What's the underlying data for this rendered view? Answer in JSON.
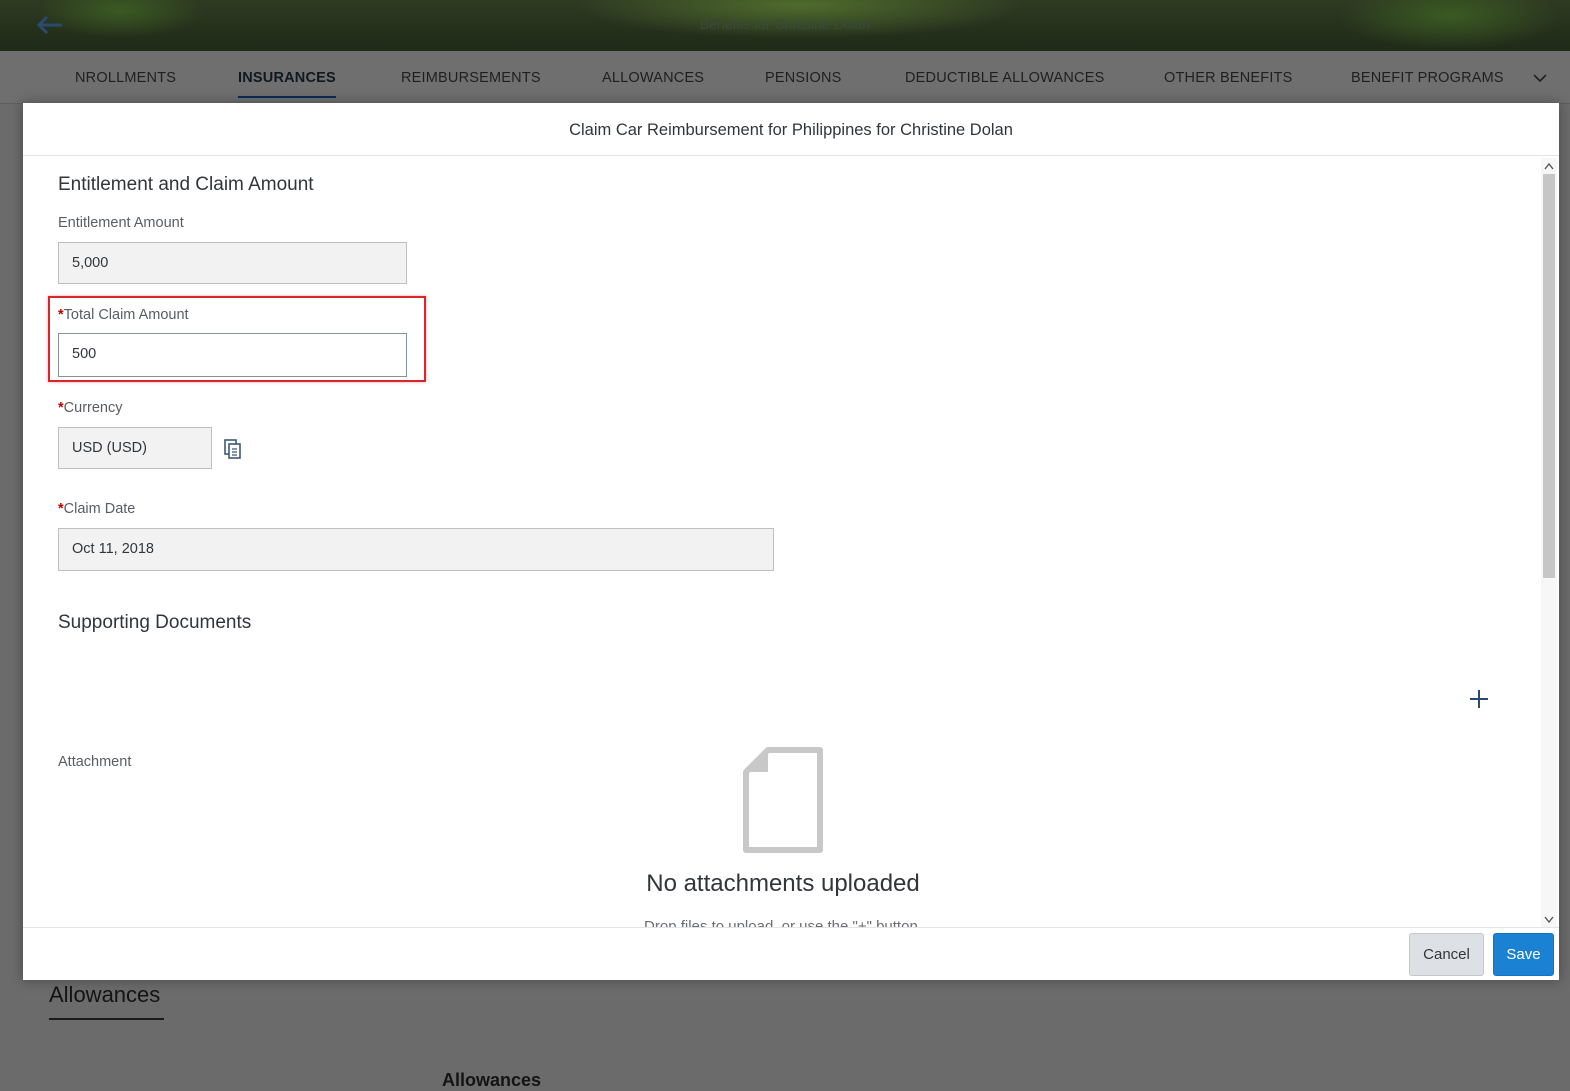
{
  "page": {
    "header_title": "Benefits for Christine Dolan"
  },
  "tabs": [
    {
      "label": "NROLLMENTS",
      "active": false
    },
    {
      "label": "INSURANCES",
      "active": true
    },
    {
      "label": "REIMBURSEMENTS",
      "active": false
    },
    {
      "label": "ALLOWANCES",
      "active": false
    },
    {
      "label": "PENSIONS",
      "active": false
    },
    {
      "label": "DEDUCTIBLE ALLOWANCES",
      "active": false
    },
    {
      "label": "OTHER BENEFITS",
      "active": false
    },
    {
      "label": "BENEFIT PROGRAMS",
      "active": false
    }
  ],
  "background": {
    "section_heading": "Allowances",
    "sub_heading": "Allowances"
  },
  "dialog": {
    "title": "Claim Car Reimbursement for Philippines for Christine Dolan",
    "section_entitlement": "Entitlement and Claim Amount",
    "entitlement_label": "Entitlement Amount",
    "entitlement_value": "5,000",
    "total_claim_label": "Total Claim Amount",
    "total_claim_value": "500",
    "currency_label": "Currency",
    "currency_value": "USD (USD)",
    "claim_date_label": "Claim Date",
    "claim_date_value": "Oct 11, 2018",
    "required_marker": "*",
    "section_documents": "Supporting Documents",
    "attachment_label": "Attachment",
    "empty_title": "No attachments uploaded",
    "empty_subtitle": "Drop files to upload, or use the \"+\" button.",
    "cancel_label": "Cancel",
    "save_label": "Save"
  },
  "colors": {
    "accent": "#1b82d3",
    "required": "#bb0000",
    "highlight_border": "#d9262b",
    "active_tab_underline": "#0a2a55"
  },
  "icons": [
    "back-arrow-icon",
    "chevron-down-icon",
    "copy-icon",
    "add-icon",
    "document-icon",
    "scroll-up-icon",
    "scroll-down-icon"
  ]
}
